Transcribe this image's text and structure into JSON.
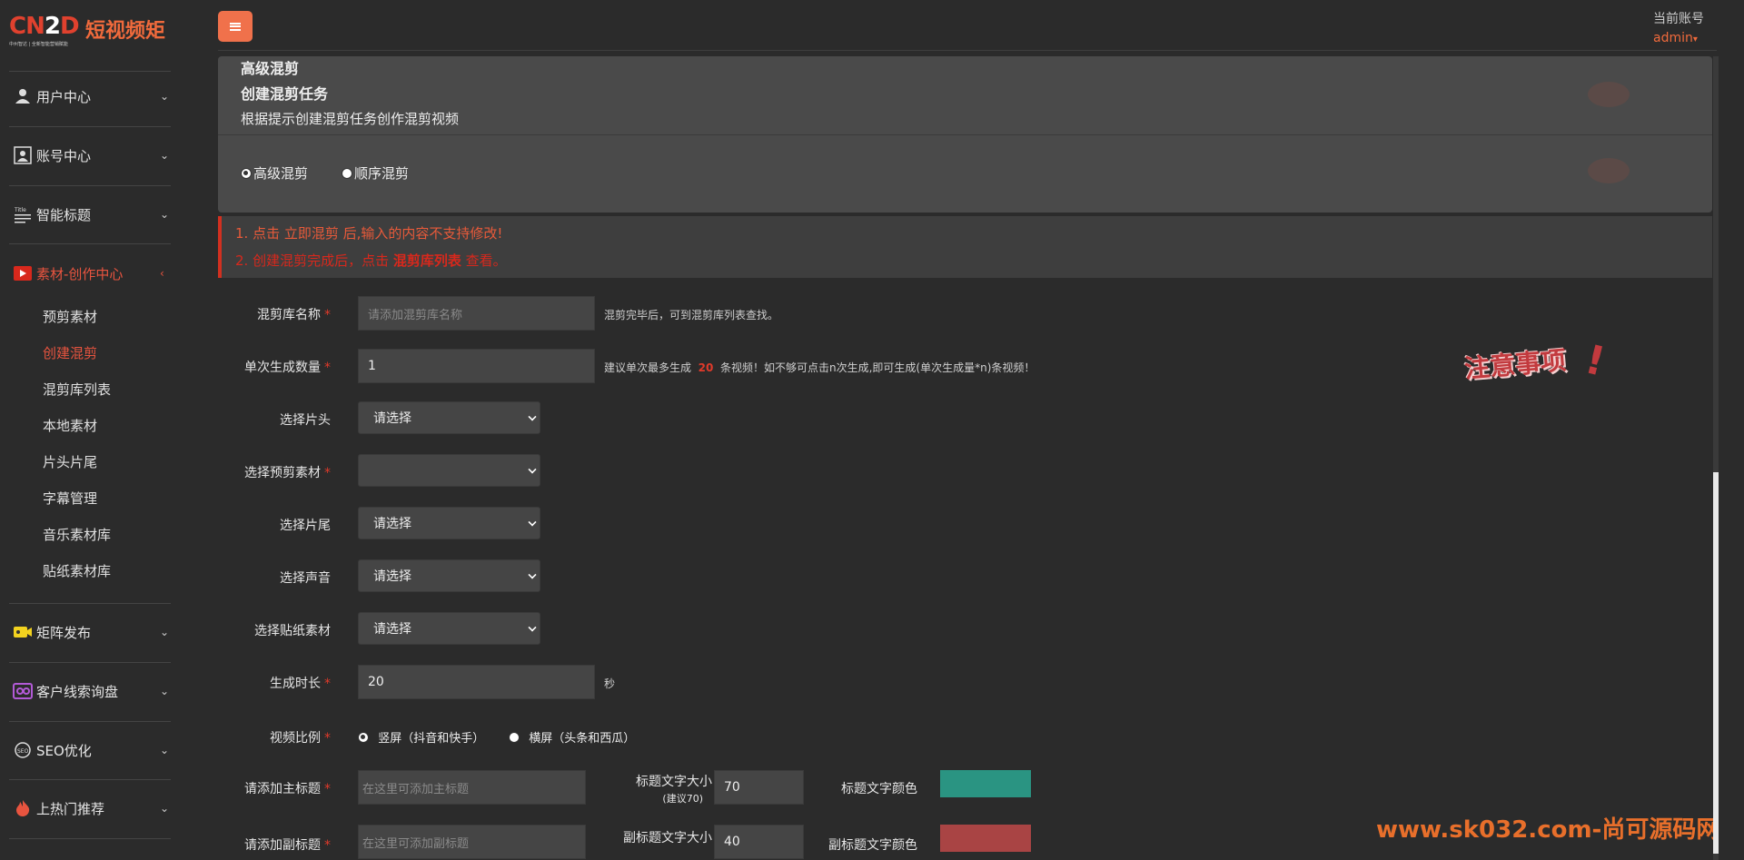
{
  "logo": {
    "cn": "CN",
    "z": "2",
    "d": "D",
    "brand": "短视频矩",
    "tagline": "中州智达 | 全新智能营销赋能"
  },
  "sidebar": {
    "items": [
      {
        "label": "用户中心",
        "icon": "user-icon"
      },
      {
        "label": "账号中心",
        "icon": "account-icon"
      },
      {
        "label": "智能标题",
        "icon": "title-icon"
      },
      {
        "label": "素材-创作中心",
        "icon": "video-icon"
      },
      {
        "label": "矩阵发布",
        "icon": "camera-icon"
      },
      {
        "label": "客户线索询盘",
        "icon": "inquiry-icon"
      },
      {
        "label": "SEO优化",
        "icon": "seo-icon"
      },
      {
        "label": "上热门推荐",
        "icon": "fire-icon"
      }
    ],
    "subitems": [
      "预剪素材",
      "创建混剪",
      "混剪库列表",
      "本地素材",
      "片头片尾",
      "字幕管理",
      "音乐素材库",
      "贴纸素材库"
    ],
    "active_sub": "创建混剪"
  },
  "header": {
    "account_label": "当前账号",
    "account_name": "admin"
  },
  "panel": {
    "title": "高级混剪",
    "subtitle": "创建混剪任务",
    "desc": "根据提示创建混剪任务创作混剪视频",
    "radios": [
      "高级混剪",
      "顺序混剪"
    ],
    "radio_selected": "高级混剪"
  },
  "notice": {
    "line1": "1. 点击 立即混剪 后,输入的内容不支持修改!",
    "line2_a": "2. 创建混剪完成后，点击",
    "line2_b": "混剪库列表",
    "line2_c": "查看。"
  },
  "form": {
    "name_label": "混剪库名称",
    "name_placeholder": "请添加混剪库名称",
    "name_hint": "混剪完毕后，可到混剪库列表查找。",
    "count_label": "单次生成数量",
    "count_value": "1",
    "count_hint_a": "建议单次最多生成",
    "count_hint_num": "20",
    "count_hint_b": "条视频！如不够可点击n次生成,即可生成(单次生成量*n)条视频！",
    "intro_label": "选择片头",
    "intro_value": "请选择",
    "material_label": "选择预剪素材",
    "material_value": "",
    "outro_label": "选择片尾",
    "outro_value": "请选择",
    "voice_label": "选择声音",
    "voice_value": "请选择",
    "sticker_label": "选择贴纸素材",
    "sticker_value": "请选择",
    "duration_label": "生成时长",
    "duration_value": "20",
    "duration_unit": "秒",
    "ratio_label": "视频比例",
    "ratio_options": [
      "竖屏（抖音和快手）",
      "横屏（头条和西瓜）"
    ],
    "ratio_selected": "竖屏（抖音和快手）",
    "main_title_label": "请添加主标题",
    "main_title_placeholder": "在这里可添加主标题",
    "main_size_label": "标题文字大小",
    "main_size_note": "(建议70)",
    "main_size_value": "70",
    "main_color_label": "标题文字颜色",
    "main_color": "#2a9482",
    "sub_title_label": "请添加副标题",
    "sub_title_placeholder": "在这里可添加副标题",
    "sub_size_label": "副标题文字大小",
    "sub_size_value": "40",
    "sub_color_label": "副标题文字颜色",
    "sub_color": "#a94444"
  },
  "stamp_text": "注意事项",
  "watermark": "www.sk032.com-尚可源码网"
}
